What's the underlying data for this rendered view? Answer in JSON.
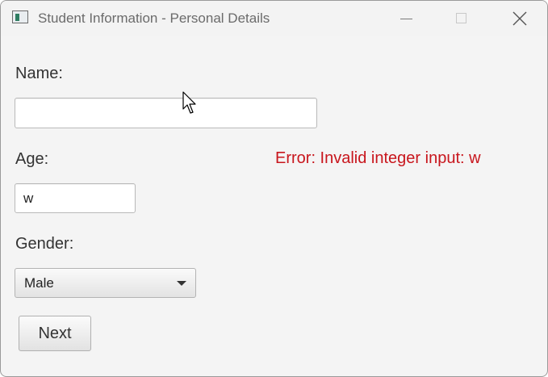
{
  "window": {
    "title": "Student Information - Personal Details"
  },
  "form": {
    "name_label": "Name:",
    "name_value": "",
    "age_label": "Age:",
    "age_value": "w",
    "gender_label": "Gender:",
    "gender_selected": "Male",
    "next_label": "Next",
    "error_message": "Error: Invalid integer input: w"
  },
  "colors": {
    "error": "#c8161d",
    "background": "#f4f4f4"
  },
  "icons": [
    "app-icon",
    "minimize-icon",
    "maximize-icon",
    "close-icon",
    "chevron-down-icon",
    "mouse-cursor-icon"
  ]
}
